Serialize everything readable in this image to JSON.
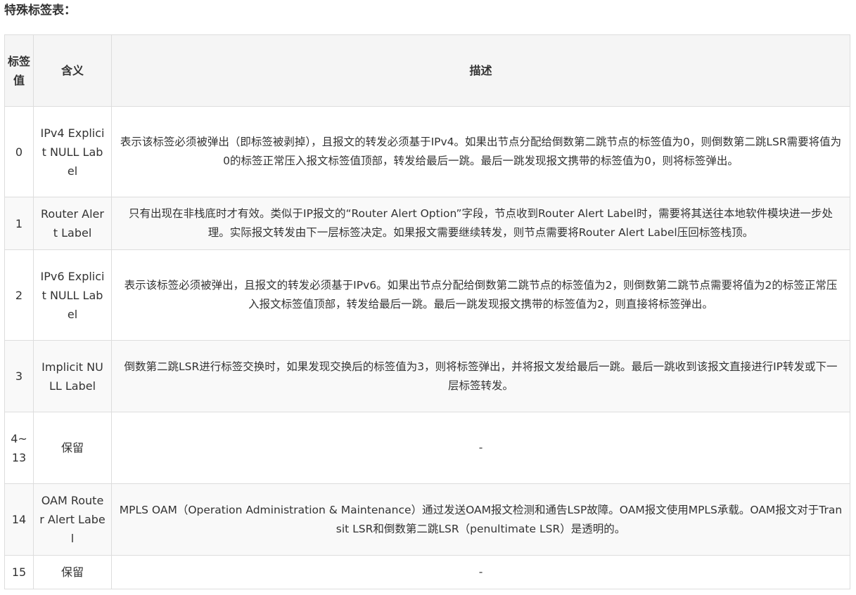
{
  "title": "特殊标签表：",
  "table": {
    "headers": {
      "value": "标签值",
      "meaning": "含义",
      "description": "描述"
    },
    "rows": [
      {
        "value": "0",
        "meaning": "IPv4 Explicit NULL Label",
        "description": "表示该标签必须被弹出（即标签被剥掉），且报文的转发必须基于IPv4。如果出节点分配给倒数第二跳节点的标签值为0，则倒数第二跳LSR需要将值为0的标签正常压入报文标签值顶部，转发给最后一跳。最后一跳发现报文携带的标签值为0，则将标签弹出。"
      },
      {
        "value": "1",
        "meaning": "Router Alert Label",
        "description": "只有出现在非栈底时才有效。类似于IP报文的“Router Alert Option”字段，节点收到Router Alert Label时，需要将其送往本地软件模块进一步处理。实际报文转发由下一层标签决定。如果报文需要继续转发，则节点需要将Router Alert Label压回标签栈顶。"
      },
      {
        "value": "2",
        "meaning": "IPv6 Explicit NULL Label",
        "description": "表示该标签必须被弹出，且报文的转发必须基于IPv6。如果出节点分配给倒数第二跳节点的标签值为2，则倒数第二跳节点需要将值为2的标签正常压入报文标签值顶部，转发给最后一跳。最后一跳发现报文携带的标签值为2，则直接将标签弹出。"
      },
      {
        "value": "3",
        "meaning": "Implicit NULL Label",
        "description": "倒数第二跳LSR进行标签交换时，如果发现交换后的标签值为3，则将标签弹出，并将报文发给最后一跳。最后一跳收到该报文直接进行IP转发或下一层标签转发。"
      },
      {
        "value": "4~13",
        "meaning": "保留",
        "description": "-"
      },
      {
        "value": "14",
        "meaning": "OAM Router Alert Label",
        "description": "MPLS OAM（Operation Administration & Maintenance）通过发送OAM报文检测和通告LSP故障。OAM报文使用MPLS承载。OAM报文对于Transit LSR和倒数第二跳LSR（penultimate LSR）是透明的。"
      },
      {
        "value": "15",
        "meaning": "保留",
        "description": "-"
      }
    ]
  }
}
